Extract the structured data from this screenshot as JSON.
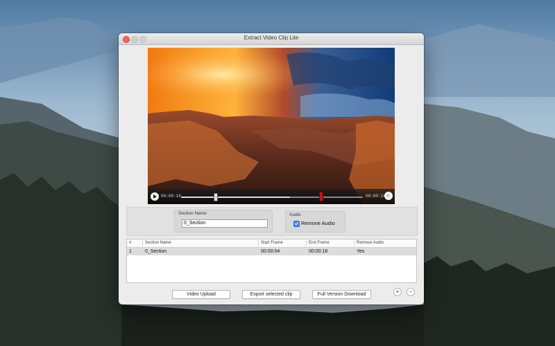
{
  "window": {
    "title": "Extract Video Clip Lite"
  },
  "player": {
    "current_time": "00:00:16",
    "total_time": "00:00:24",
    "progress": 0.6,
    "clip_start_fraction": 0.19,
    "clip_end_fraction": 0.77,
    "play_icon": "play-icon",
    "volume_icon": "volume-icon"
  },
  "editor": {
    "section_name_label": "Section Name",
    "section_name_value": "0_Section",
    "audio_label": "Audio",
    "remove_audio_label": "Remove Audio",
    "remove_audio_checked": true
  },
  "table": {
    "columns": [
      "#",
      "Section Name",
      "Start Frame",
      "End Frame",
      "Remove Audio"
    ],
    "rows": [
      [
        "1",
        "0_Section",
        "00:00:04",
        "00:00:18",
        "Yes"
      ]
    ]
  },
  "buttons": {
    "video_upload": "Video Upload",
    "export_selected": "Export selected clip",
    "full_version": "Full Version Download",
    "add": "+",
    "remove": "−"
  },
  "colors": {
    "accent": "#3b87f0",
    "close": "#fc5f57",
    "end_marker": "#c01818"
  }
}
